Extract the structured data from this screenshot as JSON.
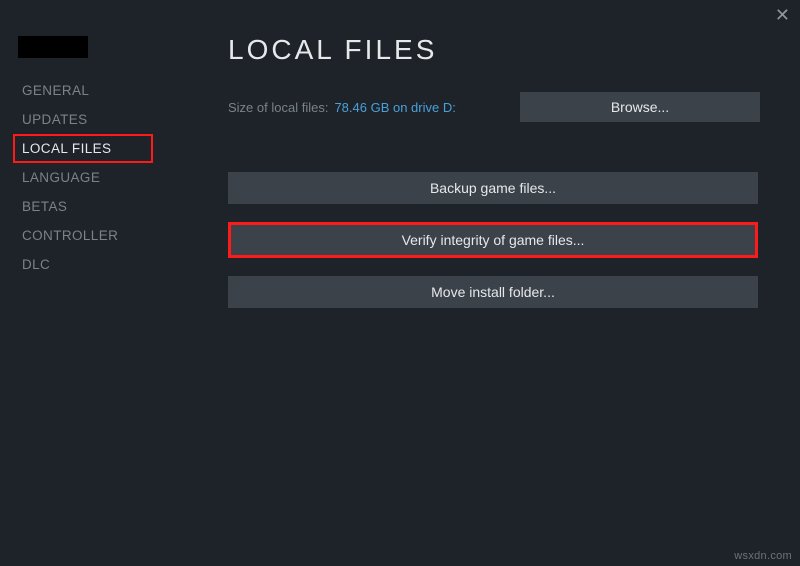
{
  "close_glyph": "✕",
  "sidebar": {
    "items": [
      {
        "label": "GENERAL"
      },
      {
        "label": "UPDATES"
      },
      {
        "label": "LOCAL FILES"
      },
      {
        "label": "LANGUAGE"
      },
      {
        "label": "BETAS"
      },
      {
        "label": "CONTROLLER"
      },
      {
        "label": "DLC"
      }
    ]
  },
  "main": {
    "title": "LOCAL FILES",
    "size_label": "Size of local files:",
    "size_value": "78.46 GB on drive D:",
    "browse_label": "Browse...",
    "backup_label": "Backup game files...",
    "verify_label": "Verify integrity of game files...",
    "move_label": "Move install folder..."
  },
  "watermark": "wsxdn.com"
}
